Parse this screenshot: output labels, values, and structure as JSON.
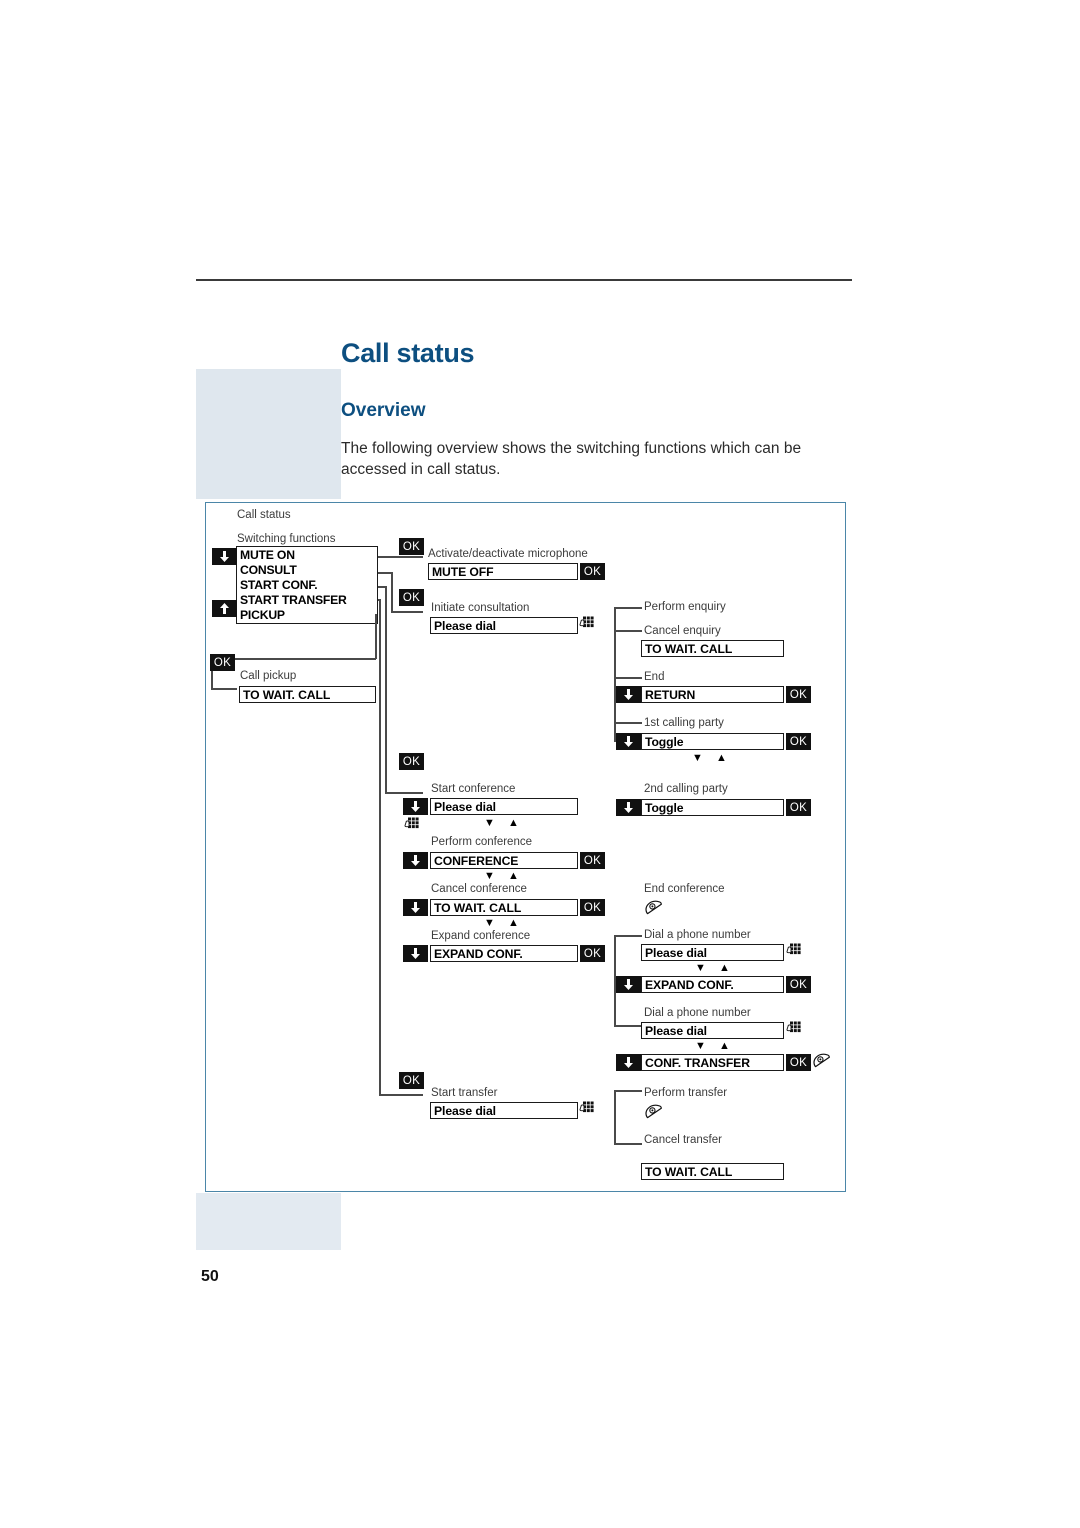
{
  "page": {
    "title": "Call status",
    "section": "Overview",
    "intro": "The following overview shows the switching functions which can be accessed in call status.",
    "number": "50",
    "accent_color": "#0d4f80",
    "band_color": "#dfe7ee",
    "frame_color": "#4b86a8"
  },
  "diagram": {
    "root_label": "Call status",
    "menu_caption": "Switching functions",
    "menu_items": [
      "MUTE ON",
      "CONSULT",
      "START CONF.",
      "START TRANSFER",
      "PICKUP"
    ],
    "keys": {
      "ok": "OK",
      "down_arrow": "down-arrow-key",
      "up_arrow": "up-arrow-key"
    },
    "icons": {
      "keypad": "keypad-icon",
      "handset": "handset-hangup-icon",
      "nav_down": "nav-down-triangle",
      "nav_up": "nav-up-triangle"
    },
    "branches": {
      "mute": {
        "caption": "Activate/deactivate microphone",
        "display": "MUTE OFF",
        "key": "OK"
      },
      "pickup": {
        "caption": "Call pickup",
        "display": "TO WAIT. CALL"
      },
      "consult": {
        "caption": "Initiate consultation",
        "display": "Please dial",
        "children": [
          {
            "caption": "Perform enquiry"
          },
          {
            "caption": "Cancel enquiry",
            "display": "TO WAIT. CALL"
          },
          {
            "caption": "End",
            "display": "RETURN",
            "key": "OK"
          },
          {
            "caption": "1st calling party",
            "display": "Toggle",
            "key": "OK"
          }
        ]
      },
      "conference": {
        "caption": "Start conference",
        "display": "Please dial",
        "steps": [
          {
            "caption": "Perform conference",
            "display": "CONFERENCE",
            "key": "OK"
          },
          {
            "caption": "Cancel conference",
            "display": "TO WAIT. CALL",
            "key": "OK"
          },
          {
            "caption": "Expand conference",
            "display": "EXPAND CONF.",
            "key": "OK"
          }
        ],
        "side": [
          {
            "caption": "2nd calling party",
            "display": "Toggle",
            "key": "OK"
          },
          {
            "caption": "End conference"
          }
        ],
        "expand": [
          {
            "caption": "Dial a phone number",
            "display": "Please dial"
          },
          {
            "display": "EXPAND CONF.",
            "key": "OK"
          },
          {
            "caption": "Dial a phone number",
            "display": "Please dial"
          },
          {
            "display": "CONF. TRANSFER",
            "key": "OK"
          }
        ]
      },
      "transfer": {
        "caption": "Start transfer",
        "display": "Please dial",
        "children": [
          {
            "caption": "Perform transfer"
          },
          {
            "caption": "Cancel transfer",
            "display": "TO WAIT. CALL"
          }
        ]
      }
    }
  }
}
